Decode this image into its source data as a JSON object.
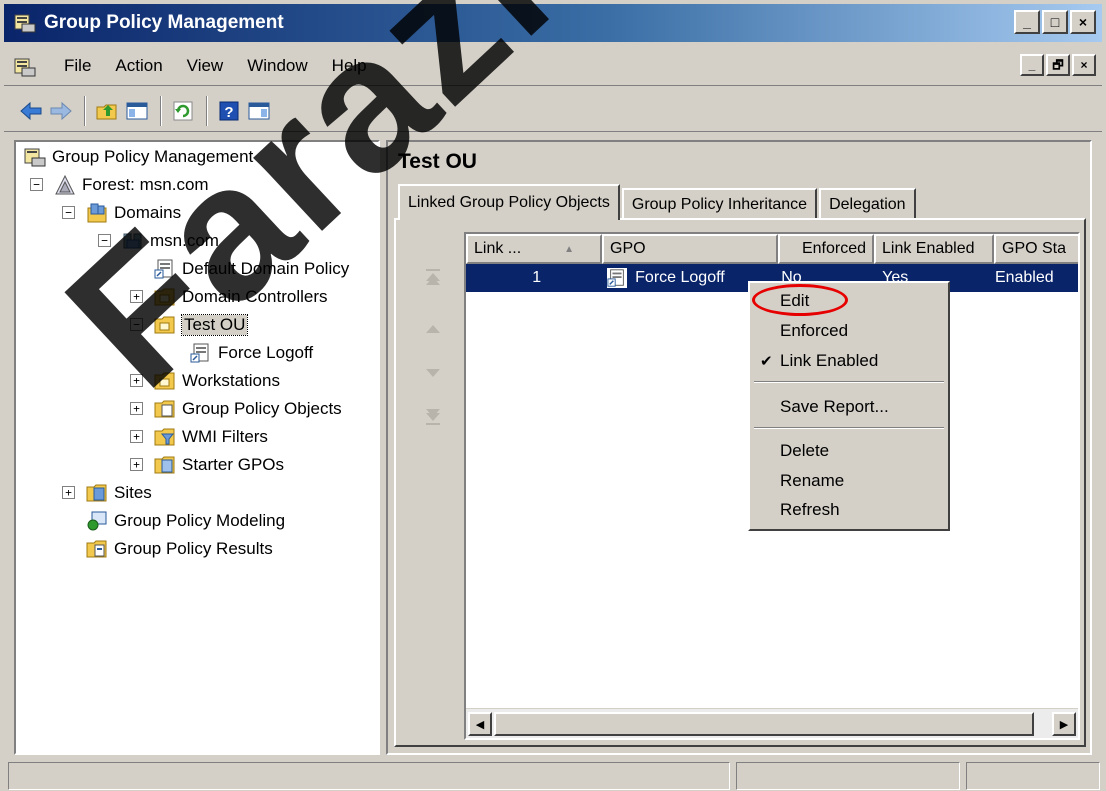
{
  "window": {
    "title": "Group Policy Management",
    "caption_buttons": [
      "_",
      "□",
      "×"
    ],
    "mdi_buttons": [
      "_",
      "🗗",
      "×"
    ]
  },
  "menu": {
    "items": [
      {
        "label": "File"
      },
      {
        "label": "Action"
      },
      {
        "label": "View"
      },
      {
        "label": "Window"
      },
      {
        "label": "Help"
      }
    ]
  },
  "toolbar": {
    "icons": [
      "back-arrow-icon",
      "forward-arrow-icon",
      "up-folder-icon",
      "show-hide-tree-icon",
      "refresh-icon",
      "help-icon",
      "show-action-pane-icon"
    ]
  },
  "tree": {
    "root": "Group Policy Management",
    "forest": "Forest: msn.com",
    "domains": "Domains",
    "domain": "msn.com",
    "default_policy": "Default Domain Policy",
    "domain_controllers": "Domain Controllers",
    "test_ou": "Test OU",
    "force_logoff": "Force Logoff",
    "workstations": "Workstations",
    "gpo_objects": "Group Policy Objects",
    "wmi_filters": "WMI Filters",
    "starter_gpos": "Starter GPOs",
    "sites": "Sites",
    "modeling": "Group Policy Modeling",
    "results": "Group Policy Results",
    "expander_plus": "+",
    "expander_minus": "−"
  },
  "details": {
    "title": "Test OU",
    "tabs": [
      {
        "label": "Linked Group Policy Objects",
        "active": true
      },
      {
        "label": "Group Policy Inheritance",
        "active": false
      },
      {
        "label": "Delegation",
        "active": false
      }
    ],
    "columns": [
      "Link ...",
      "GPO",
      "Enforced",
      "Link Enabled",
      "GPO Sta"
    ],
    "sort_indicator": "▲",
    "rows": [
      {
        "link_order": "1",
        "gpo": "Force Logoff",
        "enforced": "No",
        "link_enabled": "Yes",
        "gpo_status": "Enabled"
      }
    ],
    "scroll_left": "◀",
    "scroll_right": "▶"
  },
  "context_menu": {
    "items": [
      {
        "label": "Edit",
        "checked": false
      },
      {
        "label": "Enforced",
        "checked": false
      },
      {
        "label": "Link Enabled",
        "checked": true
      },
      {
        "label": "Save Report...",
        "checked": false
      },
      {
        "label": "Delete",
        "checked": false
      },
      {
        "label": "Rename",
        "checked": false
      },
      {
        "label": "Refresh",
        "checked": false
      }
    ],
    "check_glyph": "✔"
  },
  "watermark": "FarazNe",
  "colors": {
    "selection": "#0a246a",
    "highlight_ring": "#e60000",
    "titlebar_start": "#0a246a",
    "titlebar_end": "#a6caf0"
  }
}
